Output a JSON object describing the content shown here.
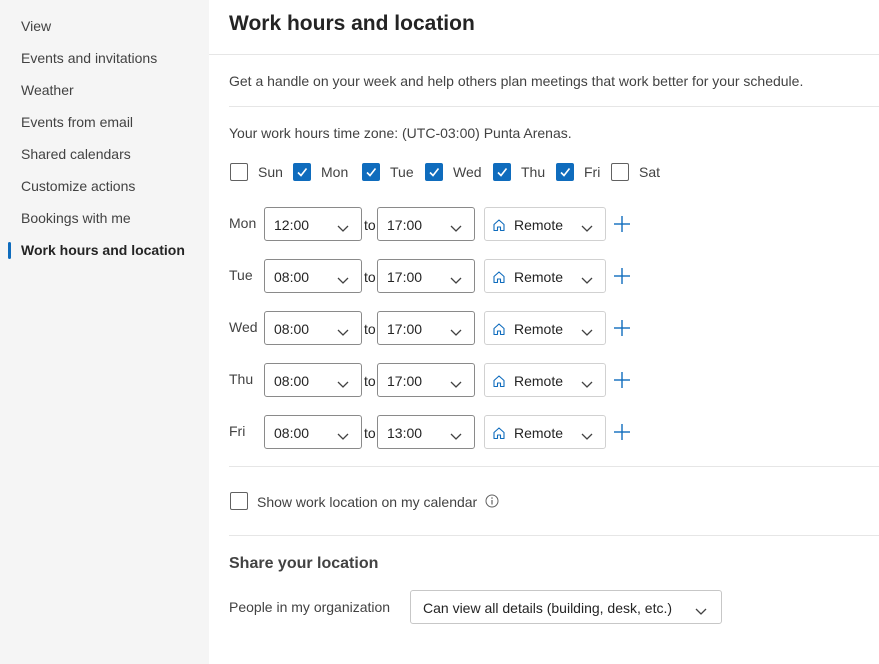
{
  "sidebar": {
    "items": [
      {
        "label": "View"
      },
      {
        "label": "Events and invitations"
      },
      {
        "label": "Weather"
      },
      {
        "label": "Events from email"
      },
      {
        "label": "Shared calendars"
      },
      {
        "label": "Customize actions"
      },
      {
        "label": "Bookings with me"
      },
      {
        "label": "Work hours and location",
        "active": true
      }
    ]
  },
  "main": {
    "title": "Work hours and location",
    "description": "Get a handle on your week and help others plan meetings that work better for your schedule.",
    "timezone_text": "Your work hours time zone: (UTC-03:00) Punta Arenas.",
    "days": [
      {
        "label": "Sun",
        "checked": false
      },
      {
        "label": "Mon",
        "checked": true
      },
      {
        "label": "Tue",
        "checked": true
      },
      {
        "label": "Wed",
        "checked": true
      },
      {
        "label": "Thu",
        "checked": true
      },
      {
        "label": "Fri",
        "checked": true
      },
      {
        "label": "Sat",
        "checked": false
      }
    ],
    "to_label": "to",
    "schedule": [
      {
        "day": "Mon",
        "start": "12:00",
        "end": "17:00",
        "location": "Remote"
      },
      {
        "day": "Tue",
        "start": "08:00",
        "end": "17:00",
        "location": "Remote"
      },
      {
        "day": "Wed",
        "start": "08:00",
        "end": "17:00",
        "location": "Remote"
      },
      {
        "day": "Thu",
        "start": "08:00",
        "end": "17:00",
        "location": "Remote"
      },
      {
        "day": "Fri",
        "start": "08:00",
        "end": "13:00",
        "location": "Remote"
      }
    ],
    "show_location": {
      "label": "Show work location on my calendar",
      "checked": false
    },
    "share": {
      "title": "Share your location",
      "label": "People in my organization",
      "value": "Can view all details (building, desk, etc.)"
    }
  },
  "colors": {
    "accent": "#0f6cbd",
    "sidebar_bg": "#f5f5f5"
  },
  "icons": [
    "chevron-down-icon",
    "home-icon",
    "plus-icon",
    "info-icon",
    "checkmark-icon"
  ]
}
